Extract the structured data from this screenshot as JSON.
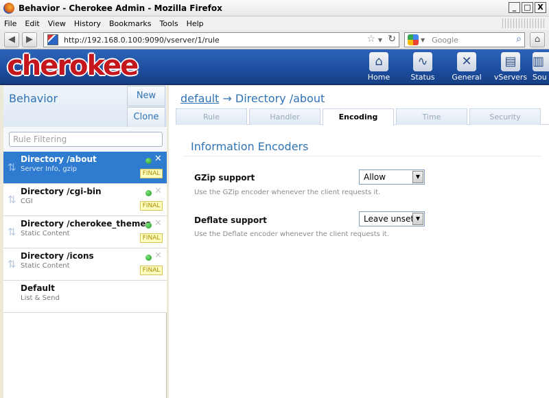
{
  "window": {
    "title": "Behavior - Cherokee Admin - Mozilla Firefox",
    "controls": [
      "_",
      "□",
      "X"
    ]
  },
  "menu": [
    "File",
    "Edit",
    "View",
    "History",
    "Bookmarks",
    "Tools",
    "Help"
  ],
  "browser": {
    "url": "http://192.168.0.100:9090/vserver/1/rule",
    "search_placeholder": "Google"
  },
  "app": {
    "logo": "cherokee",
    "nav": [
      {
        "label": "Home",
        "icon": "home-icon",
        "glyph": "⌂"
      },
      {
        "label": "Status",
        "icon": "status-icon",
        "glyph": "∿"
      },
      {
        "label": "General",
        "icon": "general-icon",
        "glyph": "✕"
      },
      {
        "label": "vServers",
        "icon": "vservers-icon",
        "glyph": "▤"
      },
      {
        "label": "Sou",
        "icon": "sources-icon",
        "glyph": "▥"
      }
    ]
  },
  "sidebar": {
    "title": "Behavior",
    "new_label": "New",
    "clone_label": "Clone",
    "filter_placeholder": "Rule Filtering",
    "rules": [
      {
        "name": "Directory /about",
        "sub": "Server Info, gzip",
        "final": "FINAL",
        "active": true
      },
      {
        "name": "Directory /cgi-bin",
        "sub": "CGI",
        "final": "FINAL",
        "active": false
      },
      {
        "name": "Directory /cherokee_themes",
        "sub": "Static Content",
        "final": "FINAL",
        "active": false
      },
      {
        "name": "Directory /icons",
        "sub": "Static Content",
        "final": "FINAL",
        "active": false
      },
      {
        "name": "Default",
        "sub": "List & Send",
        "final": "",
        "active": false
      }
    ]
  },
  "main": {
    "breadcrumb_link": "default",
    "breadcrumb_arrow": " → ",
    "breadcrumb_rest": "Directory /about",
    "tabs": [
      "Rule",
      "Handler",
      "Encoding",
      "Time",
      "Security"
    ],
    "active_tab": "Encoding",
    "section_title": "Information Encoders",
    "fields": [
      {
        "label": "GZip support",
        "value": "Allow",
        "help": "Use the GZip encoder whenever the client requests it."
      },
      {
        "label": "Deflate support",
        "value": "Leave unset",
        "help": "Use the Deflate encoder whenever the client requests it."
      }
    ]
  }
}
